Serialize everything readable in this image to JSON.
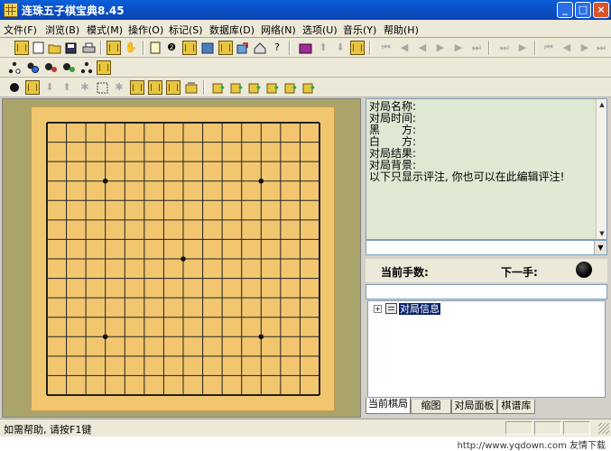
{
  "window": {
    "title": "连珠五子棋宝典8.45",
    "min_label": "_",
    "max_label": "□",
    "close_label": "×"
  },
  "menu": [
    {
      "label": "文件(F)"
    },
    {
      "label": "浏览(B)"
    },
    {
      "label": "模式(M)"
    },
    {
      "label": "操作(O)"
    },
    {
      "label": "标记(S)"
    },
    {
      "label": "数据库(D)"
    },
    {
      "label": "网络(N)"
    },
    {
      "label": "选项(U)"
    },
    {
      "label": "音乐(Y)"
    },
    {
      "label": "帮助(H)"
    }
  ],
  "toolbar_glyphs": {
    "help": "?",
    "star": "✱",
    "nav_first": "⏮",
    "nav_prev": "◀",
    "nav_next": "▶",
    "nav_last": "⏭",
    "up": "⬆",
    "down": "⬇",
    "numbered": "❷"
  },
  "info": {
    "lines": [
      "对局名称:",
      "对局时间:",
      "黑　　方:",
      "白　　方:",
      "对局结果:",
      "对局背景:",
      "以下只显示评注, 你也可以在此编辑评注!"
    ]
  },
  "status_row": {
    "current_moves_label": "当前手数:",
    "next_move_label": "下一手:"
  },
  "tree": {
    "expander": "+",
    "root_label": "对局信息"
  },
  "tabs": [
    {
      "label": "当前棋局"
    },
    {
      "label": "缩图"
    },
    {
      "label": "对局面板"
    },
    {
      "label": "棋谱库"
    }
  ],
  "statusbar": {
    "text": "如需帮助, 请按F1键"
  },
  "watermark": {
    "text": "http://www.yqdown.com 友情下载"
  },
  "colors": {
    "board": "#f2c66f",
    "board_frame": "#aaa46a",
    "info_bg": "#dfe8d2",
    "titlebar": "#0b4fc4"
  },
  "board": {
    "size": 15,
    "star_points": [
      [
        4,
        4
      ],
      [
        12,
        4
      ],
      [
        8,
        8
      ],
      [
        4,
        12
      ],
      [
        12,
        12
      ]
    ]
  }
}
